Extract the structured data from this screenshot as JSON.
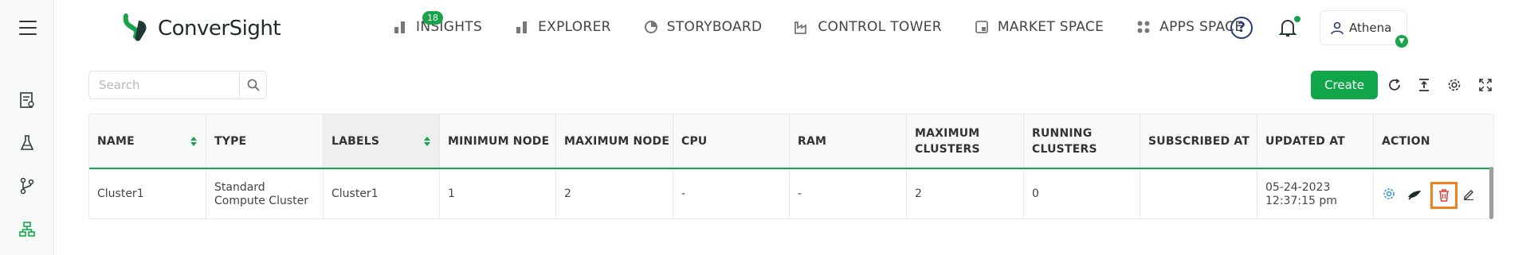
{
  "app": {
    "brand": "ConverSight"
  },
  "nav": [
    {
      "label": "INSIGHTS",
      "icon": "bar-chart-icon"
    },
    {
      "label": "EXPLORER",
      "icon": "bar-chart-icon"
    },
    {
      "label": "STORYBOARD",
      "icon": "pie-chart-icon"
    },
    {
      "label": "CONTROL TOWER",
      "icon": "factory-icon"
    },
    {
      "label": "MARKET SPACE",
      "icon": "store-icon"
    },
    {
      "label": "APPS SPACE",
      "icon": "apps-grid-icon"
    }
  ],
  "storyboard_badge": "18",
  "header": {
    "help": "?",
    "user_name": "Athena"
  },
  "toolbar": {
    "search_placeholder": "Search",
    "create_label": "Create"
  },
  "table": {
    "columns": [
      "NAME",
      "TYPE",
      "LABELS",
      "MINIMUM NODE",
      "MAXIMUM NODE",
      "CPU",
      "RAM",
      "MAXIMUM CLUSTERS",
      "RUNNING CLUSTERS",
      "SUBSCRIBED AT",
      "UPDATED AT",
      "ACTION"
    ],
    "rows": [
      {
        "name": "Cluster1",
        "type": "Standard Compute Cluster",
        "labels": "Cluster1",
        "min_node": "1",
        "max_node": "2",
        "cpu": "-",
        "ram": "-",
        "max_clusters": "2",
        "running_clusters": "0",
        "subscribed_at": "",
        "updated_at": "05-24-2023 12:37:15 pm"
      }
    ]
  },
  "colors": {
    "brand_green": "#12a64a",
    "highlight_orange": "#f07f1d",
    "navy": "#2c3a74",
    "delete_red": "#e53935",
    "settings_blue": "#2f8fd8"
  }
}
